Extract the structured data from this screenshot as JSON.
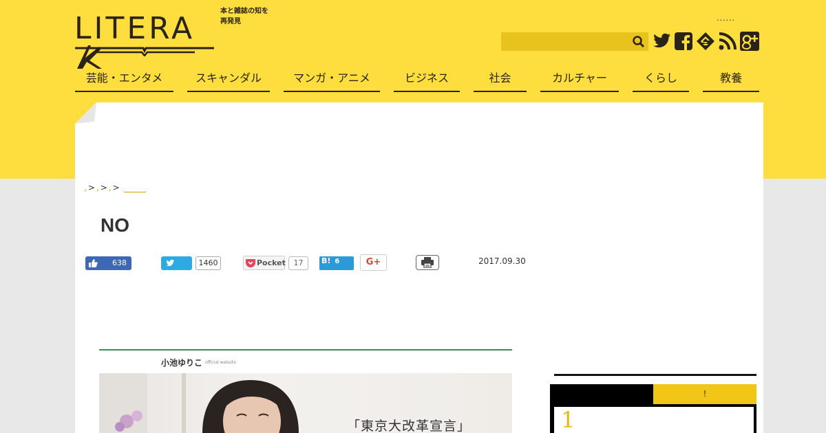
{
  "header": {
    "logo_text": "LITERA",
    "tagline": "本と雑誌の知を再発見",
    "top_dots": "......",
    "search": {
      "value": "",
      "placeholder": ""
    },
    "social_icons": [
      "twitter-icon",
      "facebook-icon",
      "feedly-icon",
      "rss-icon",
      "google-plus-icon"
    ]
  },
  "nav": {
    "items": [
      {
        "label": "芸能・エンタメ"
      },
      {
        "label": "スキャンダル"
      },
      {
        "label": "マンガ・アニメ"
      },
      {
        "label": "ビジネス"
      },
      {
        "label": "社会"
      },
      {
        "label": "カルチャー"
      },
      {
        "label": "くらし"
      },
      {
        "label": "教養"
      }
    ]
  },
  "breadcrumb": {
    "crumbs": [
      ",",
      ",",
      ","
    ],
    "separator": ">"
  },
  "article": {
    "title": "NO",
    "date": "2017.09.30",
    "share": {
      "facebook_count": "638",
      "twitter_count": "1460",
      "pocket_label": "Pocket",
      "pocket_count": "17",
      "hatena_label": "B!",
      "hatena_count": "6",
      "gplus_label": "G+"
    },
    "hero": {
      "brand": "小池ゆりこ",
      "brand_sub": "official website",
      "slogan": "「東京大改革宣言」"
    }
  },
  "sidebar": {
    "tab_b_label": "!",
    "rank_first": "1"
  },
  "colors": {
    "brand_yellow": "#fedd3f",
    "search_yellow": "#e9c31d",
    "dark": "#2a2318",
    "facebook": "#3c68b4",
    "twitter": "#2daae1",
    "hatena": "#2a9ad8",
    "rank_gold": "#e8b810"
  }
}
